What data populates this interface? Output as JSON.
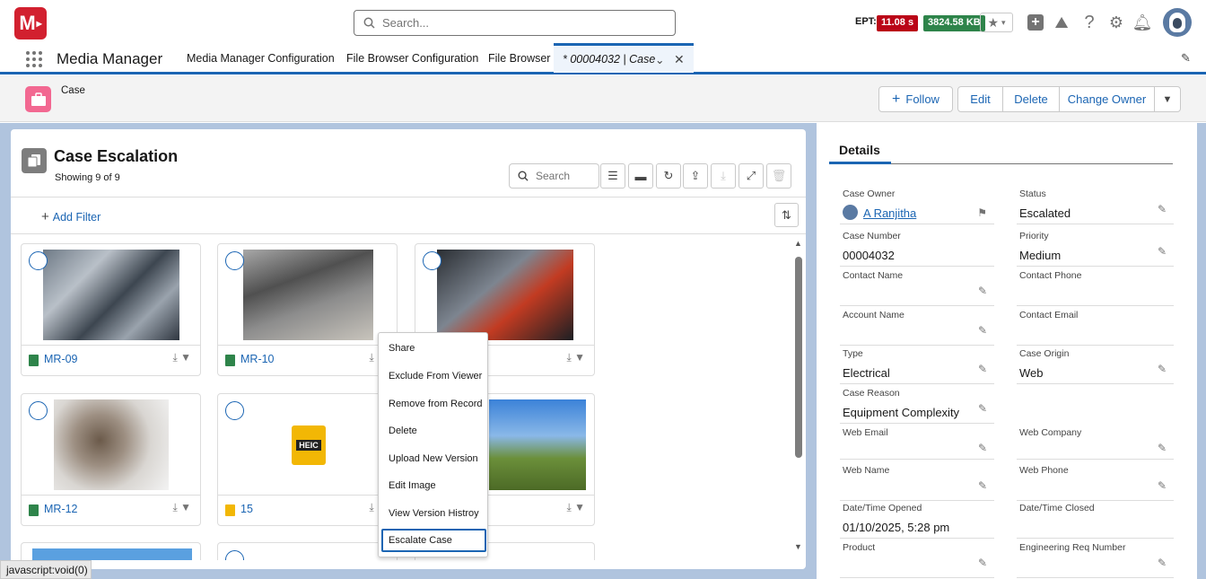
{
  "header": {
    "logo_text": "M",
    "search_placeholder": "Search...",
    "ept_label": "EPT:",
    "ept_value": "11.08 s",
    "kb_value": "3824.58 KB",
    "colors": {
      "ept": "#ba0517",
      "kb": "#2e844a"
    }
  },
  "nav": {
    "app_name": "Media Manager",
    "tabs": [
      "Media Manager Configuration",
      "File Browser Configuration",
      "File Browser"
    ],
    "active_tab": "* 00004032 | Case"
  },
  "page": {
    "object_label": "Case",
    "buttons": {
      "follow": "Follow",
      "edit": "Edit",
      "delete": "Delete",
      "change_owner": "Change Owner"
    }
  },
  "gallery": {
    "title": "Case Escalation",
    "showing": "Showing 9 of 9",
    "search_placeholder": "Search",
    "add_filter": "Add Filter",
    "tiles": [
      {
        "name": "MR-09"
      },
      {
        "name": "MR-10"
      },
      {
        "name": ""
      },
      {
        "name": "MR-12"
      },
      {
        "name": "15",
        "heic": "HEIC"
      },
      {
        "name": ""
      }
    ]
  },
  "context_menu": {
    "items": [
      "Share",
      "Exclude From Viewer",
      "Remove from Record",
      "Delete",
      "Upload New Version",
      "Edit Image",
      "View Version Histroy",
      "Escalate Case"
    ]
  },
  "details": {
    "tab": "Details",
    "fields": [
      {
        "label": "Case Owner",
        "value": "A Ranjitha",
        "link": true
      },
      {
        "label": "Status",
        "value": "Escalated"
      },
      {
        "label": "Case Number",
        "value": "00004032"
      },
      {
        "label": "Priority",
        "value": "Medium"
      },
      {
        "label": "Contact Name",
        "value": ""
      },
      {
        "label": "Contact Phone",
        "value": ""
      },
      {
        "label": "Account Name",
        "value": ""
      },
      {
        "label": "Contact Email",
        "value": ""
      },
      {
        "label": "Type",
        "value": "Electrical"
      },
      {
        "label": "Case Origin",
        "value": "Web"
      },
      {
        "label": "Case Reason",
        "value": "Equipment Complexity"
      },
      {
        "label": "",
        "value": ""
      },
      {
        "label": "Web Email",
        "value": ""
      },
      {
        "label": "Web Company",
        "value": ""
      },
      {
        "label": "Web Name",
        "value": ""
      },
      {
        "label": "Web Phone",
        "value": ""
      },
      {
        "label": "Date/Time Opened",
        "value": "01/10/2025, 5:28 pm"
      },
      {
        "label": "Date/Time Closed",
        "value": ""
      },
      {
        "label": "Product",
        "value": ""
      },
      {
        "label": "Engineering Req Number",
        "value": ""
      }
    ]
  },
  "status_bar": "javascript:void(0)"
}
